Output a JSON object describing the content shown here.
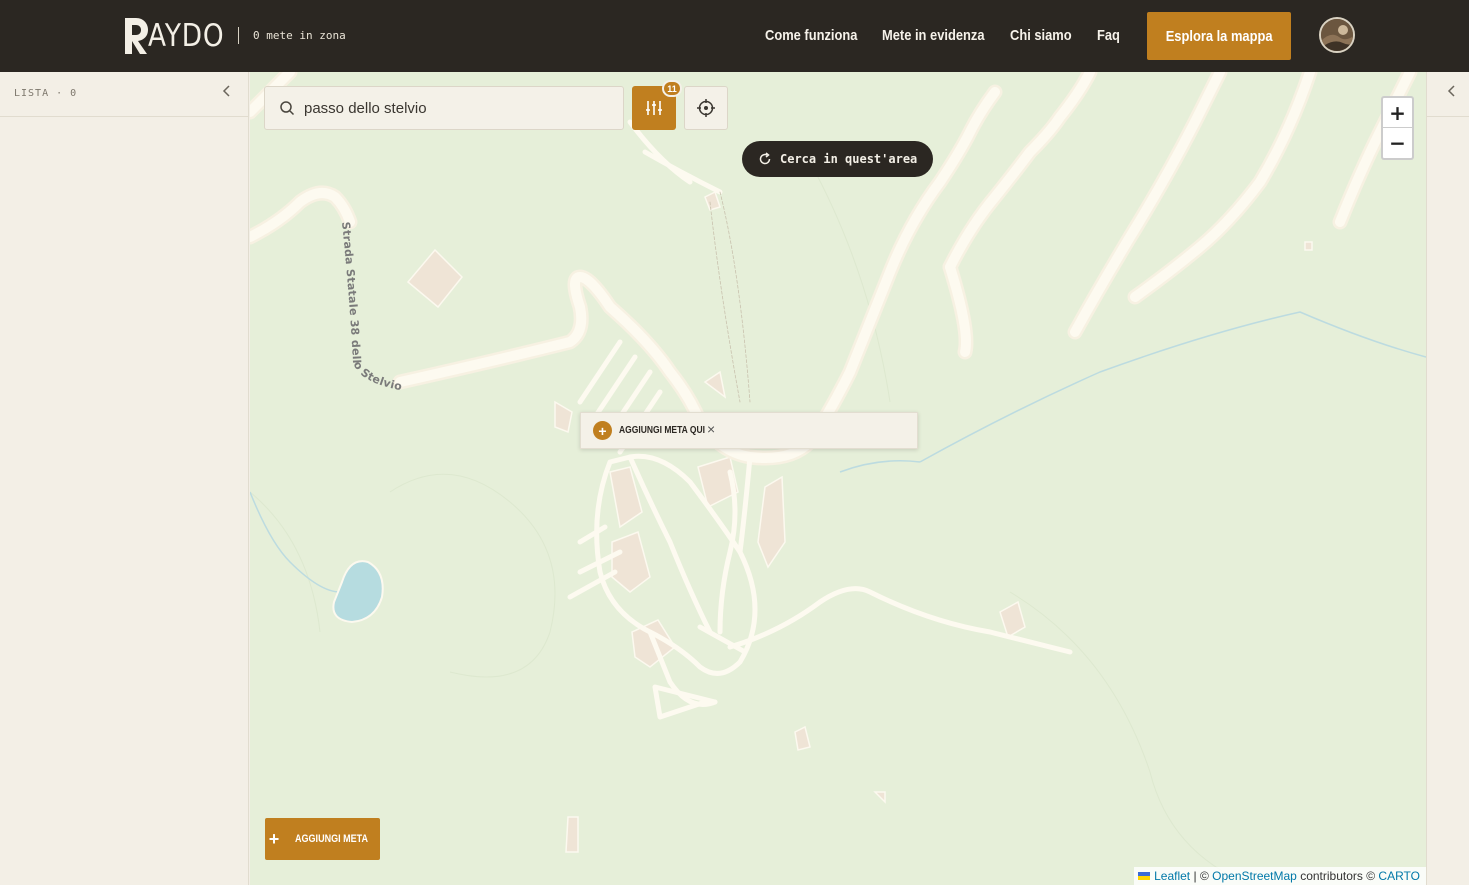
{
  "header": {
    "logo_text": "AYDO",
    "mete_count": "0 mete in zona",
    "nav": [
      {
        "label": "Come funziona"
      },
      {
        "label": "Mete in evidenza"
      },
      {
        "label": "Chi siamo"
      },
      {
        "label": "Faq"
      }
    ],
    "cta_label": "Esplora la mappa",
    "avatar_icon": "user-avatar"
  },
  "left_panel": {
    "title": "LISTA · 0",
    "collapse_icon": "chevron-left-icon"
  },
  "right_panel": {
    "collapse_icon": "chevron-left-icon"
  },
  "map": {
    "search": {
      "value": "passo dello stelvio",
      "icon": "search-icon"
    },
    "filter": {
      "icon": "sliders-icon",
      "badge": "11",
      "color": "#c07f1f"
    },
    "locate_icon": "crosshair-icon",
    "search_area_label": "Cerca in quest'area",
    "zoom_in": "+",
    "zoom_out": "−",
    "road_label": "Strada Statale 38 dello Stelvio",
    "popup": {
      "label": "AGGIUNGI META QUI",
      "close": "×"
    },
    "add_button_label": "AGGIUNGI META",
    "attribution": {
      "leaflet": "Leaflet",
      "sep": "|",
      "copy1": "©",
      "osm": "OpenStreetMap",
      "contrib": "contributors ©",
      "carto": "CARTO"
    }
  },
  "colors": {
    "topbar": "#2b2722",
    "accent": "#c07f1f",
    "panel": "#f3efe6",
    "map_bg": "#e6efd9",
    "road": "#fcf9ef"
  }
}
